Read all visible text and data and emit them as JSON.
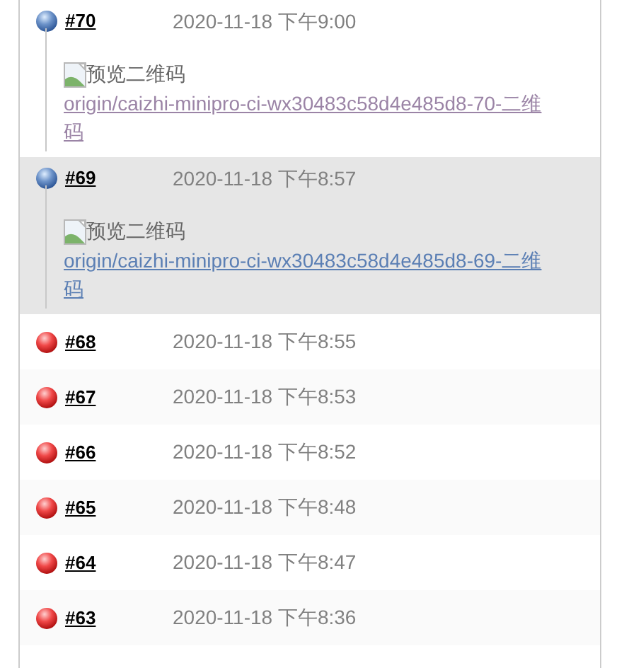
{
  "builds": [
    {
      "number": "#70",
      "time": "2020-11-18 下午9:00",
      "kind": "success",
      "selected": false,
      "preview_alt": "预览二维码",
      "link": "origin/caizhi-minipro-ci-wx30483c58d4e485d8-70-二维码",
      "visited": true
    },
    {
      "number": "#69",
      "time": "2020-11-18 下午8:57",
      "kind": "success",
      "selected": true,
      "preview_alt": "预览二维码",
      "link": "origin/caizhi-minipro-ci-wx30483c58d4e485d8-69-二维码",
      "visited": false
    },
    {
      "number": "#68",
      "time": "2020-11-18 下午8:55",
      "kind": "failed",
      "selected": false
    },
    {
      "number": "#67",
      "time": "2020-11-18 下午8:53",
      "kind": "failed",
      "selected": false
    },
    {
      "number": "#66",
      "time": "2020-11-18 下午8:52",
      "kind": "failed",
      "selected": false
    },
    {
      "number": "#65",
      "time": "2020-11-18 下午8:48",
      "kind": "failed",
      "selected": false
    },
    {
      "number": "#64",
      "time": "2020-11-18 下午8:47",
      "kind": "failed",
      "selected": false
    },
    {
      "number": "#63",
      "time": "2020-11-18 下午8:36",
      "kind": "failed",
      "selected": false
    }
  ]
}
